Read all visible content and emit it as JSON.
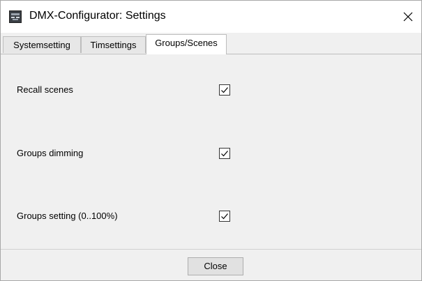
{
  "window": {
    "title": "DMX-Configurator: Settings",
    "close_icon": "close-icon",
    "app_icon": "app-icon"
  },
  "tabs": [
    {
      "label": "Systemsetting",
      "active": false
    },
    {
      "label": "Timsettings",
      "active": false
    },
    {
      "label": "Groups/Scenes",
      "active": true
    }
  ],
  "settings": [
    {
      "label": "Recall scenes",
      "checked": true
    },
    {
      "label": "Groups dimming",
      "checked": true
    },
    {
      "label": "Groups setting (0..100%)",
      "checked": true
    }
  ],
  "footer": {
    "close_label": "Close"
  }
}
